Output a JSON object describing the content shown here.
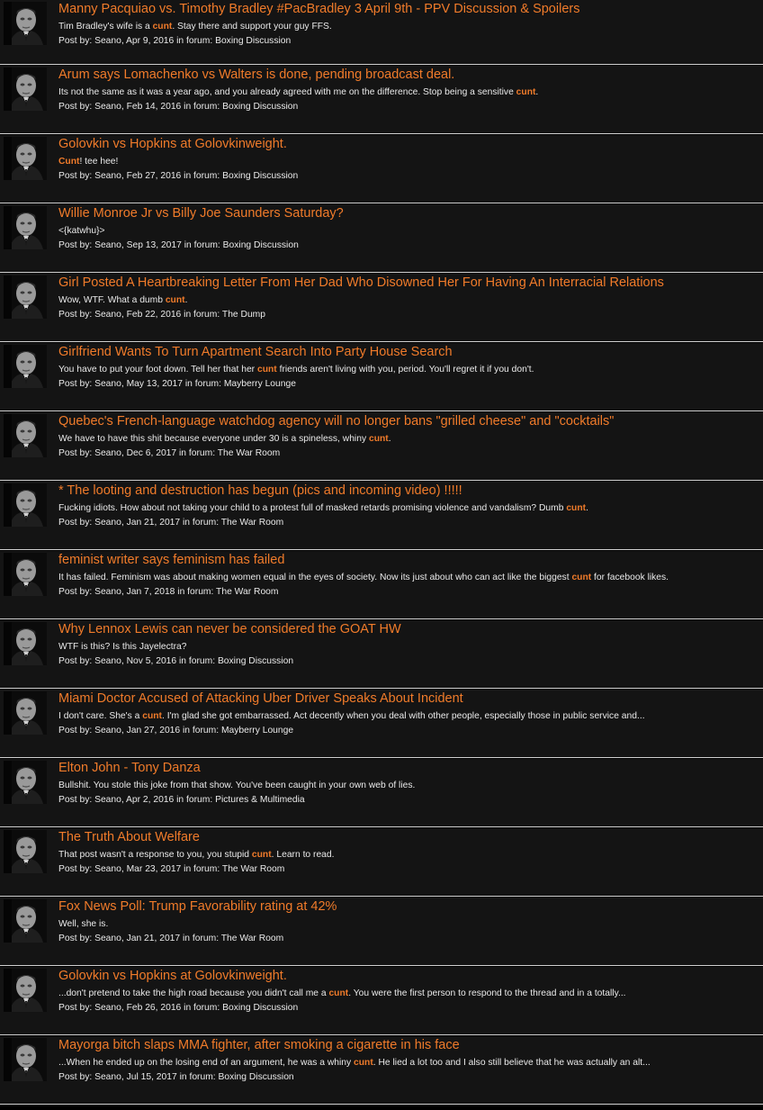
{
  "labels": {
    "posted_by": "Post by:",
    "in_forum": "in forum:"
  },
  "highlight_color": "#f07b2a",
  "avatar_icon": "godfather-avatar-icon",
  "results": [
    {
      "title": "Manny Pacquiao vs. Timothy Bradley #PacBradley 3 April 9th - PPV Discussion & Spoilers",
      "snippet": [
        {
          "t": "Tim Bradley's wife is a "
        },
        {
          "t": "cunt",
          "hl": true
        },
        {
          "t": ". Stay there and support your guy FFS."
        }
      ],
      "poster": "Seano",
      "date": "Apr 9, 2016",
      "forum": "Boxing Discussion"
    },
    {
      "title": "Arum says Lomachenko vs Walters is done, pending broadcast deal.",
      "snippet": [
        {
          "t": "Its not the same as it was a year ago, and you already agreed with me on the difference. Stop being a sensitive "
        },
        {
          "t": "cunt",
          "hl": true
        },
        {
          "t": "."
        }
      ],
      "poster": "Seano",
      "date": "Feb 14, 2016",
      "forum": "Boxing Discussion"
    },
    {
      "title": "Golovkin vs Hopkins at Golovkinweight.",
      "snippet": [
        {
          "t": "Cunt",
          "hl": true
        },
        {
          "t": "! tee hee!"
        }
      ],
      "poster": "Seano",
      "date": "Feb 27, 2016",
      "forum": "Boxing Discussion"
    },
    {
      "title": "Willie Monroe Jr vs Billy Joe Saunders Saturday?",
      "snippet": [
        {
          "t": "<{katwhu}>"
        }
      ],
      "poster": "Seano",
      "date": "Sep 13, 2017",
      "forum": "Boxing Discussion"
    },
    {
      "title": "Girl Posted A Heartbreaking Letter From Her Dad Who Disowned Her For Having An Interracial Relations",
      "snippet": [
        {
          "t": "Wow, WTF. What a dumb "
        },
        {
          "t": "cunt",
          "hl": true
        },
        {
          "t": "."
        }
      ],
      "poster": "Seano",
      "date": "Feb 22, 2016",
      "forum": "The Dump"
    },
    {
      "title": "Girlfriend Wants To Turn Apartment Search Into Party House Search",
      "snippet": [
        {
          "t": "You have to put your foot down. Tell her that her "
        },
        {
          "t": "cunt",
          "hl": true
        },
        {
          "t": " friends aren't living with you, period. You'll regret it if you don't."
        }
      ],
      "poster": "Seano",
      "date": "May 13, 2017",
      "forum": "Mayberry Lounge"
    },
    {
      "title": "Quebec's French-language watchdog agency will no longer bans \"grilled cheese\" and \"cocktails\"",
      "snippet": [
        {
          "t": "We have to have this shit because everyone under 30 is a spineless, whiny "
        },
        {
          "t": "cunt",
          "hl": true
        },
        {
          "t": "."
        }
      ],
      "poster": "Seano",
      "date": "Dec 6, 2017",
      "forum": "The War Room"
    },
    {
      "title": "* The looting and destruction has begun (pics and incoming video) !!!!!",
      "snippet": [
        {
          "t": "Fucking idiots. How about not taking your child to a protest full of masked retards promising violence and vandalism? Dumb "
        },
        {
          "t": "cunt",
          "hl": true
        },
        {
          "t": "."
        }
      ],
      "poster": "Seano",
      "date": "Jan 21, 2017",
      "forum": "The War Room"
    },
    {
      "title": "feminist writer says feminism has failed",
      "snippet": [
        {
          "t": "It has failed. Feminism was about making women equal in the eyes of society. Now its just about who can act like the biggest "
        },
        {
          "t": "cunt",
          "hl": true
        },
        {
          "t": " for facebook likes."
        }
      ],
      "poster": "Seano",
      "date": "Jan 7, 2018",
      "forum": "The War Room"
    },
    {
      "title": "Why Lennox Lewis can never be considered the GOAT HW",
      "snippet": [
        {
          "t": "WTF is this? Is this Jayelectra?"
        }
      ],
      "poster": "Seano",
      "date": "Nov 5, 2016",
      "forum": "Boxing Discussion"
    },
    {
      "title": "Miami Doctor Accused of Attacking Uber Driver Speaks About Incident",
      "snippet": [
        {
          "t": "I don't care. She's a "
        },
        {
          "t": "cunt",
          "hl": true
        },
        {
          "t": ". I'm glad she got embarrassed. Act decently when you deal with other people, especially those in public service and..."
        }
      ],
      "poster": "Seano",
      "date": "Jan 27, 2016",
      "forum": "Mayberry Lounge"
    },
    {
      "title": "Elton John - Tony Danza",
      "snippet": [
        {
          "t": "Bullshit. You stole this joke from that show. You've been caught in your own web of lies."
        }
      ],
      "poster": "Seano",
      "date": "Apr 2, 2016",
      "forum": "Pictures & Multimedia"
    },
    {
      "title": "The Truth About Welfare",
      "snippet": [
        {
          "t": "That post wasn't a response to you, you stupid "
        },
        {
          "t": "cunt",
          "hl": true
        },
        {
          "t": ". Learn to read."
        }
      ],
      "poster": "Seano",
      "date": "Mar 23, 2017",
      "forum": "The War Room"
    },
    {
      "title": "Fox News Poll: Trump Favorability rating at 42%",
      "snippet": [
        {
          "t": "Well, she is."
        }
      ],
      "poster": "Seano",
      "date": "Jan 21, 2017",
      "forum": "The War Room"
    },
    {
      "title": "Golovkin vs Hopkins at Golovkinweight.",
      "snippet": [
        {
          "t": "...don't pretend to take the high road because you didn't call me a "
        },
        {
          "t": "cunt",
          "hl": true
        },
        {
          "t": ". You were the first person to respond to the thread and in a totally..."
        }
      ],
      "poster": "Seano",
      "date": "Feb 26, 2016",
      "forum": "Boxing Discussion"
    },
    {
      "title": "Mayorga bitch slaps MMA fighter, after smoking a cigarette in his face",
      "snippet": [
        {
          "t": "...When he ended up on the losing end of an argument, he was a whiny "
        },
        {
          "t": "cunt",
          "hl": true
        },
        {
          "t": ". He lied a lot too and I also still believe that he was actually an alt..."
        }
      ],
      "poster": "Seano",
      "date": "Jul 15, 2017",
      "forum": "Boxing Discussion"
    }
  ]
}
